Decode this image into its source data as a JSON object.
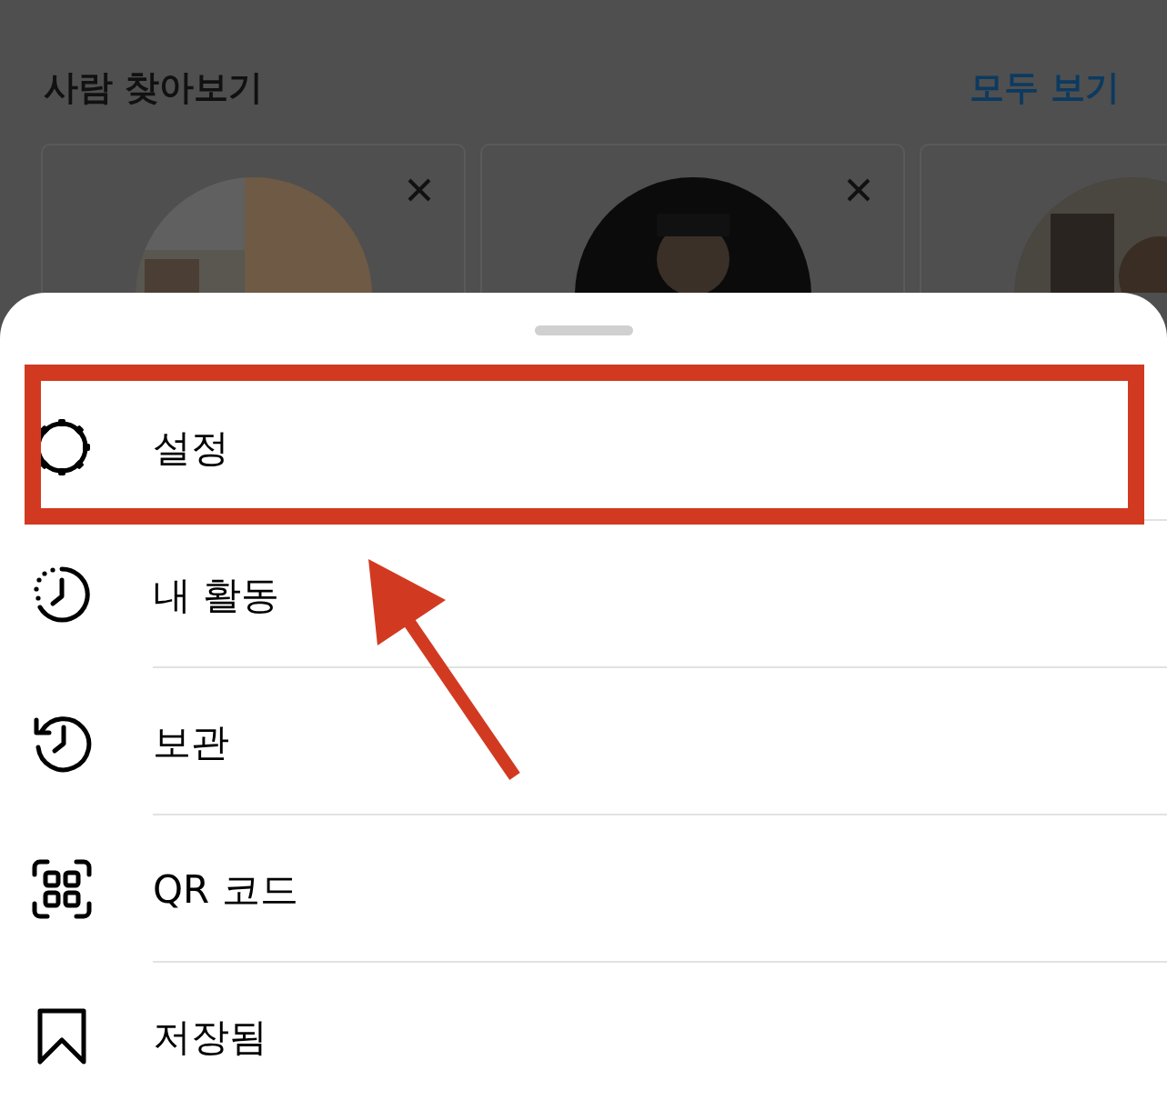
{
  "discover": {
    "title": "사람 찾아보기",
    "see_all": "모두 보기",
    "cards": [
      {
        "show_close": true
      },
      {
        "show_close": true
      },
      {
        "show_close": false
      }
    ]
  },
  "menu": {
    "items": [
      {
        "kind": "settings",
        "label": "설정",
        "highlighted": true
      },
      {
        "kind": "activity",
        "label": "내 활동",
        "highlighted": false
      },
      {
        "kind": "archive",
        "label": "보관",
        "highlighted": false
      },
      {
        "kind": "qr",
        "label": "QR 코드",
        "highlighted": false
      },
      {
        "kind": "saved",
        "label": "저장됨",
        "highlighted": false
      }
    ]
  }
}
